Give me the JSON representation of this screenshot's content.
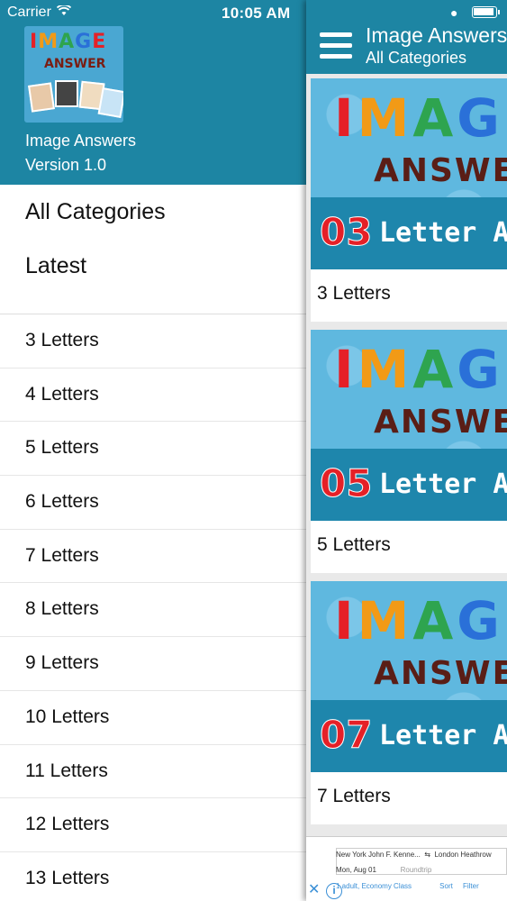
{
  "status_bar": {
    "carrier": "Carrier",
    "time": "10:05 AM"
  },
  "drawer": {
    "logo": {
      "line1": "IMAGE",
      "line2": "ANSWER"
    },
    "app_name": "Image Answers",
    "version": "Version 1.0",
    "top_items": [
      {
        "label": "All Categories"
      },
      {
        "label": "Latest"
      }
    ],
    "items": [
      {
        "label": "3 Letters"
      },
      {
        "label": "4 Letters"
      },
      {
        "label": "5 Letters"
      },
      {
        "label": "6 Letters"
      },
      {
        "label": "7 Letters"
      },
      {
        "label": "8 Letters"
      },
      {
        "label": "9 Letters"
      },
      {
        "label": "10 Letters"
      },
      {
        "label": "11 Letters"
      },
      {
        "label": "12 Letters"
      },
      {
        "label": "13 Letters"
      }
    ]
  },
  "main": {
    "title": "Image Answers",
    "subtitle": "All Categories",
    "cards": [
      {
        "banner_title": "IMAGE",
        "banner_answer": "ANSWER",
        "number": "03",
        "banner_sub": "Letter Answ",
        "label": "3 Letters"
      },
      {
        "banner_title": "IMAGE",
        "banner_answer": "ANSWER",
        "number": "05",
        "banner_sub": "Letter Answ",
        "label": "5 Letters"
      },
      {
        "banner_title": "IMAGE",
        "banner_answer": "ANSWER",
        "number": "07",
        "banner_sub": "Letter Answ",
        "label": "7 Letters"
      }
    ],
    "ad": {
      "from": "New York John F. Kenne...",
      "to": "London Heathrow",
      "date": "Mon, Aug 01",
      "trip": "Roundtrip",
      "class": "1 adult, Economy Class",
      "sort": "Sort",
      "filter": "Filter"
    }
  },
  "colors": {
    "header_teal": "#1d85a3",
    "banner_blue": "#5fb8df",
    "number_red": "#e52027"
  }
}
